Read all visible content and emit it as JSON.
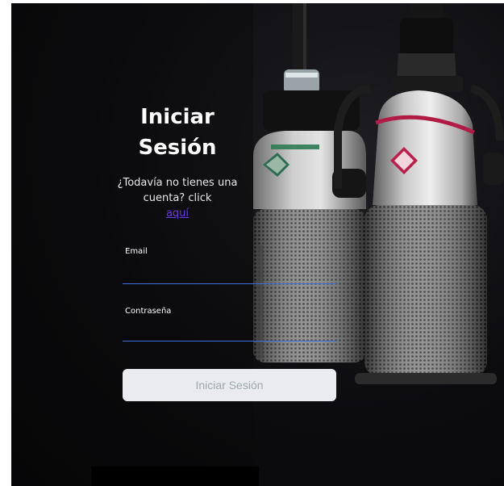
{
  "login": {
    "title": "Iniciar Sesión",
    "signup_prompt": "¿Todavía no tienes una cuenta? click",
    "signup_link": "aquí",
    "email_label": "Email",
    "email_value": "",
    "password_label": "Contraseña",
    "password_value": "",
    "submit_label": "Iniciar Sesión"
  },
  "colors": {
    "background": "#0c0c0f",
    "input_underline": "#3f6fe0",
    "link": "#6a39e0",
    "button_bg": "#e9ebee",
    "button_text": "#9fa9b0"
  }
}
